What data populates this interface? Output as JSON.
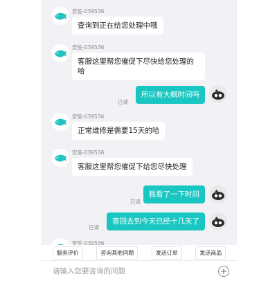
{
  "messages": [
    {
      "sender": "安笙-039536",
      "text": "查询到正在给您处理中哦"
    },
    {
      "sender": "安笙-039536",
      "text": "客服这里帮您催促下尽快给您处理的哈"
    },
    {
      "text": "所以有大概时间吗",
      "status": "已读"
    },
    {
      "sender": "安笙-039536",
      "text": "正常维修是需要15天的哈"
    },
    {
      "sender": "安笙-039536",
      "text": "客服这里帮您催促下给您尽快处理"
    },
    {
      "text": "我看了一下时间",
      "status": "已读"
    },
    {
      "text": "寄回去到今天已经十几天了",
      "status": "已读"
    },
    {
      "sender": "安笙-039536"
    }
  ],
  "quick_actions": [
    "服务评价",
    "咨询其他问题",
    "发送订单",
    "发送商品"
  ],
  "input": {
    "placeholder": "请输入您要咨询的问题"
  },
  "icons": {
    "agent_avatar": "fish-logo-icon",
    "user_avatar": "user-photo-icon",
    "plus": "plus-circle-icon"
  },
  "colors": {
    "accent": "#19c6c1",
    "background": "#f2f1f6"
  }
}
